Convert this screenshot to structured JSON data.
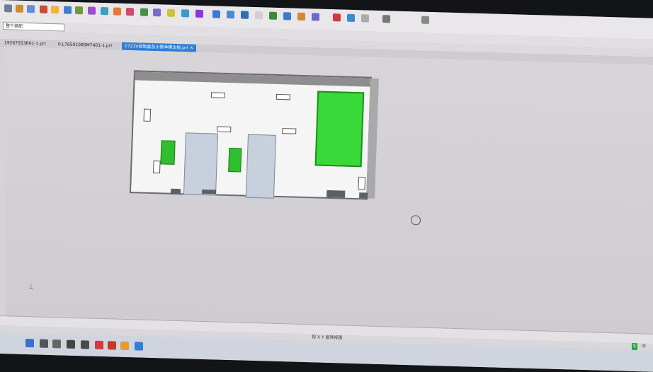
{
  "tabs": [
    {
      "label": "19267553R01-1.prt"
    },
    {
      "label": "0.L7650108SM7401-1.prt"
    },
    {
      "label": "1721V控制盒及小款本模主板.prt"
    }
  ],
  "filter_label": "整个装配",
  "status_text": "视 X Y 旋转视图",
  "ime_label": "S",
  "ime_lang": "中"
}
